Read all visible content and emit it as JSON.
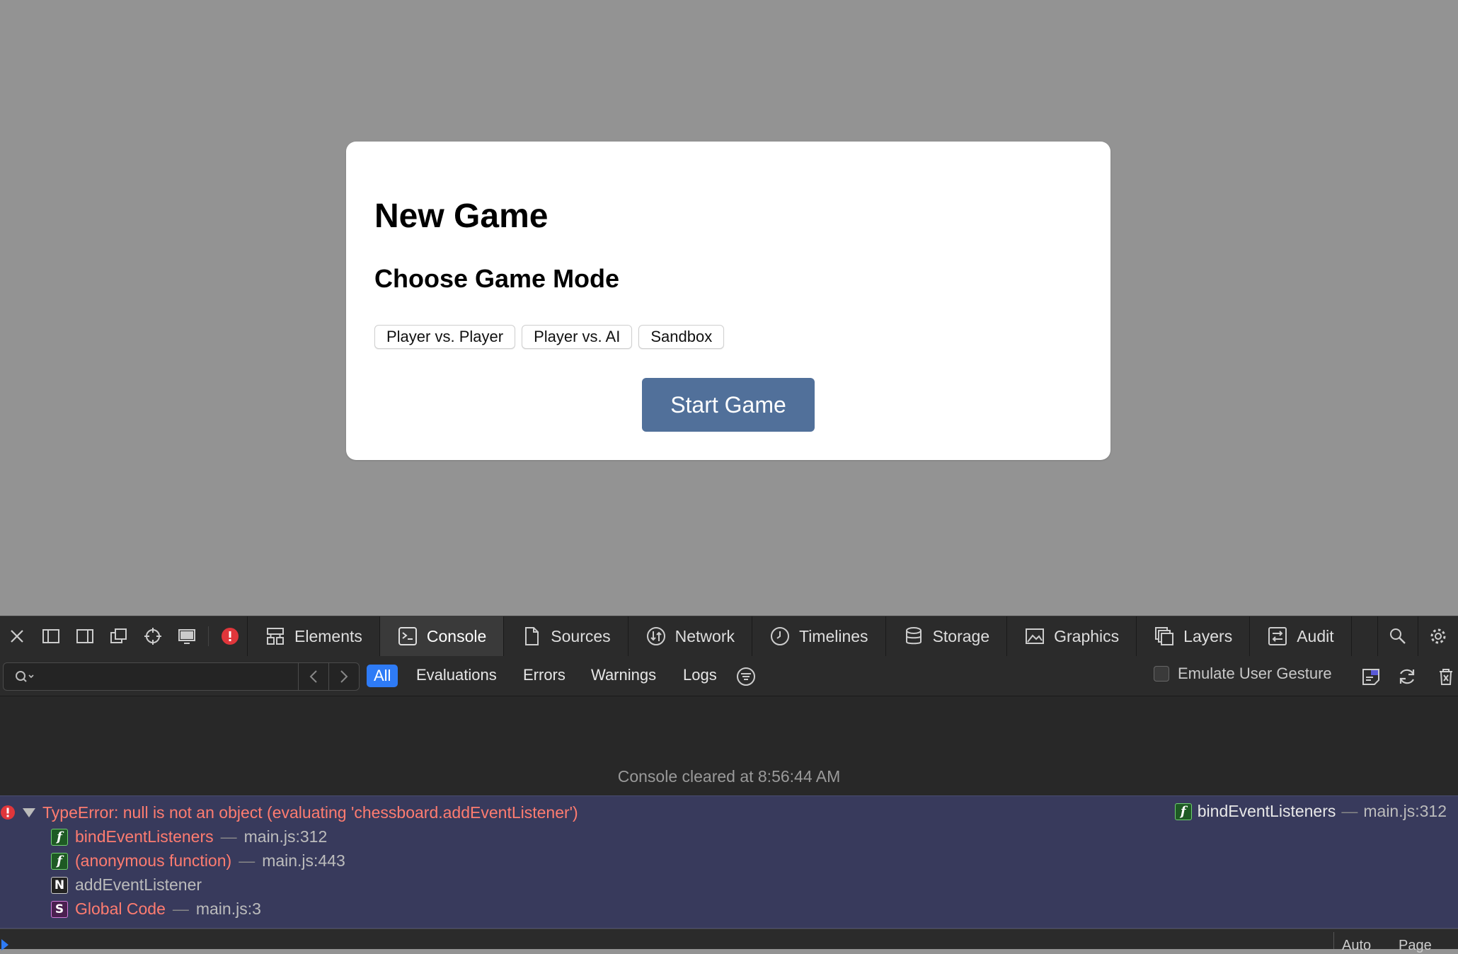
{
  "dialog": {
    "title": "New Game",
    "subtitle": "Choose Game Mode",
    "modes": [
      "Player vs. Player",
      "Player vs. AI",
      "Sandbox"
    ],
    "start_label": "Start Game"
  },
  "devtools": {
    "tabs": [
      {
        "label": "Elements",
        "icon": "elements-icon"
      },
      {
        "label": "Console",
        "icon": "console-icon",
        "active": true
      },
      {
        "label": "Sources",
        "icon": "sources-icon"
      },
      {
        "label": "Network",
        "icon": "network-icon"
      },
      {
        "label": "Timelines",
        "icon": "timelines-icon"
      },
      {
        "label": "Storage",
        "icon": "storage-icon"
      },
      {
        "label": "Graphics",
        "icon": "graphics-icon"
      },
      {
        "label": "Layers",
        "icon": "layers-icon"
      },
      {
        "label": "Audit",
        "icon": "audit-icon"
      }
    ],
    "filters": {
      "all": "All",
      "evaluations": "Evaluations",
      "errors": "Errors",
      "warnings": "Warnings",
      "logs": "Logs"
    },
    "search_placeholder": "",
    "emulate_label": "Emulate User Gesture",
    "console": {
      "cleared_message": "Console cleared at 8:56:44 AM",
      "error": {
        "message": "TypeError: null is not an object (evaluating 'chessboard.addEventListener')",
        "location_fn": "bindEventListeners",
        "location_file": "main.js:312",
        "stack": [
          {
            "type": "f",
            "name": "bindEventListeners",
            "location": "main.js:312"
          },
          {
            "type": "f",
            "name": "(anonymous function)",
            "location": "main.js:443"
          },
          {
            "type": "N",
            "name": "addEventListener",
            "location": ""
          },
          {
            "type": "S",
            "name": "Global Code",
            "location": "main.js:3"
          }
        ]
      },
      "bottom_options": [
        "Auto",
        "Page"
      ]
    },
    "colors": {
      "accent": "#2e7bf6",
      "error_text": "#ff7c70",
      "error_background": "#383a5c",
      "start_button": "#51709a"
    }
  }
}
